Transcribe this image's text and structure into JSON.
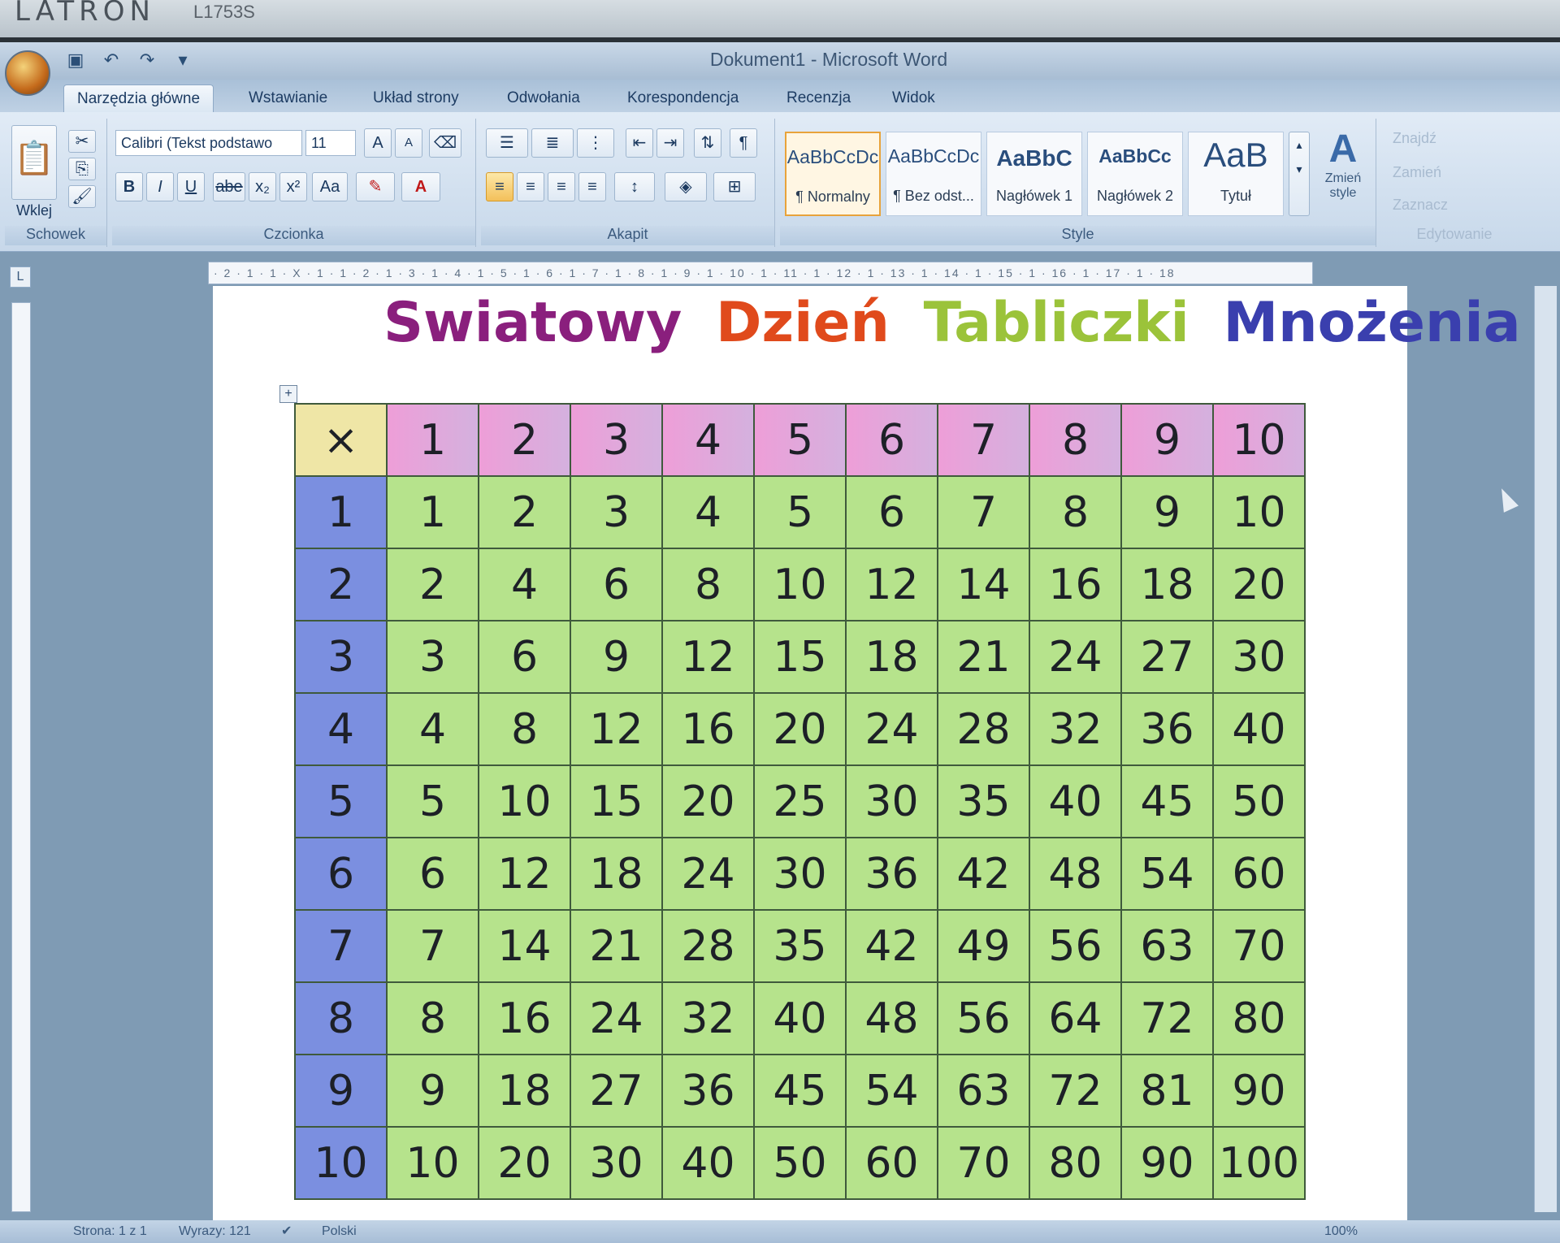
{
  "monitor": {
    "brand": "LATRON",
    "model": "L1753S"
  },
  "window": {
    "title": "Dokument1 - Microsoft Word"
  },
  "tabs": [
    "Narzędzia główne",
    "Wstawianie",
    "Układ strony",
    "Odwołania",
    "Korespondencja",
    "Recenzja",
    "Widok"
  ],
  "ribbon": {
    "clipboard": {
      "paste_label": "Wklej",
      "group_label": "Schowek"
    },
    "font": {
      "font_name": "Calibri (Tekst podstawo",
      "font_size": "11",
      "bold": "B",
      "italic": "I",
      "underline": "U",
      "strike": "abe",
      "subscript": "x₂",
      "superscript": "x²",
      "case": "Aa",
      "grow": "A",
      "shrink": "A",
      "group_label": "Czcionka"
    },
    "paragraph": {
      "group_label": "Akapit",
      "pilcrow": "¶"
    },
    "styles": {
      "group_label": "Style",
      "items": [
        {
          "sample": "AaBbCcDc",
          "name": "¶ Normalny"
        },
        {
          "sample": "AaBbCcDc",
          "name": "¶ Bez odst..."
        },
        {
          "sample": "AaBbC",
          "name": "Nagłówek 1"
        },
        {
          "sample": "AaBbCc",
          "name": "Nagłówek 2"
        },
        {
          "sample": "AaB",
          "name": "Tytuł"
        }
      ],
      "change_styles": "Zmień style"
    },
    "editing": {
      "find": "Znajdź",
      "replace": "Zamień",
      "select": "Zaznacz",
      "group_label": "Edytowanie"
    }
  },
  "ruler": {
    "text": "· 2 · 1 · 1 · X · 1 · 1 · 2 · 1 · 3 · 1 · 4 · 1 · 5 · 1 · 6 · 1 · 7 · 1 · 8 · 1 · 9 · 1 · 10 · 1 · 11 · 1 · 12 · 1 · 13 · 1 · 14 · 1 · 15 · 1 · 16 · 1 · 17 · 1 · 18"
  },
  "document": {
    "heading_words": [
      {
        "text": "Swiatowy",
        "color": "#8a1f7d"
      },
      {
        "text": "Dzień",
        "color": "#e04a1c"
      },
      {
        "text": "Tabliczki",
        "color": "#9bc33a"
      },
      {
        "text": "Mnożenia",
        "color": "#3a3fae"
      }
    ],
    "table": {
      "corner": "×",
      "column_headers": [
        "1",
        "2",
        "3",
        "4",
        "5",
        "6",
        "7",
        "8",
        "9",
        "10"
      ],
      "rows": [
        {
          "header": "1",
          "values": [
            "1",
            "2",
            "3",
            "4",
            "5",
            "6",
            "7",
            "8",
            "9",
            "10"
          ]
        },
        {
          "header": "2",
          "values": [
            "2",
            "4",
            "6",
            "8",
            "10",
            "12",
            "14",
            "16",
            "18",
            "20"
          ]
        },
        {
          "header": "3",
          "values": [
            "3",
            "6",
            "9",
            "12",
            "15",
            "18",
            "21",
            "24",
            "27",
            "30"
          ]
        },
        {
          "header": "4",
          "values": [
            "4",
            "8",
            "12",
            "16",
            "20",
            "24",
            "28",
            "32",
            "36",
            "40"
          ]
        },
        {
          "header": "5",
          "values": [
            "5",
            "10",
            "15",
            "20",
            "25",
            "30",
            "35",
            "40",
            "45",
            "50"
          ]
        },
        {
          "header": "6",
          "values": [
            "6",
            "12",
            "18",
            "24",
            "30",
            "36",
            "42",
            "48",
            "54",
            "60"
          ]
        },
        {
          "header": "7",
          "values": [
            "7",
            "14",
            "21",
            "28",
            "35",
            "42",
            "49",
            "56",
            "63",
            "70"
          ]
        },
        {
          "header": "8",
          "values": [
            "8",
            "16",
            "24",
            "32",
            "40",
            "48",
            "56",
            "64",
            "72",
            "80"
          ]
        },
        {
          "header": "9",
          "values": [
            "9",
            "18",
            "27",
            "36",
            "45",
            "54",
            "63",
            "72",
            "81",
            "90"
          ]
        },
        {
          "header": "10",
          "values": [
            "10",
            "20",
            "30",
            "40",
            "50",
            "60",
            "70",
            "80",
            "90",
            "100"
          ]
        }
      ]
    }
  },
  "status": {
    "page": "Strona: 1 z 1",
    "words": "Wyrazy: 121",
    "language": "Polski",
    "zoom": "100%"
  },
  "colors": {
    "corner": "#efe6a6",
    "column_header": "#e8a4da",
    "row_header": "#7b8fe0",
    "cell": "#b6e38c"
  }
}
